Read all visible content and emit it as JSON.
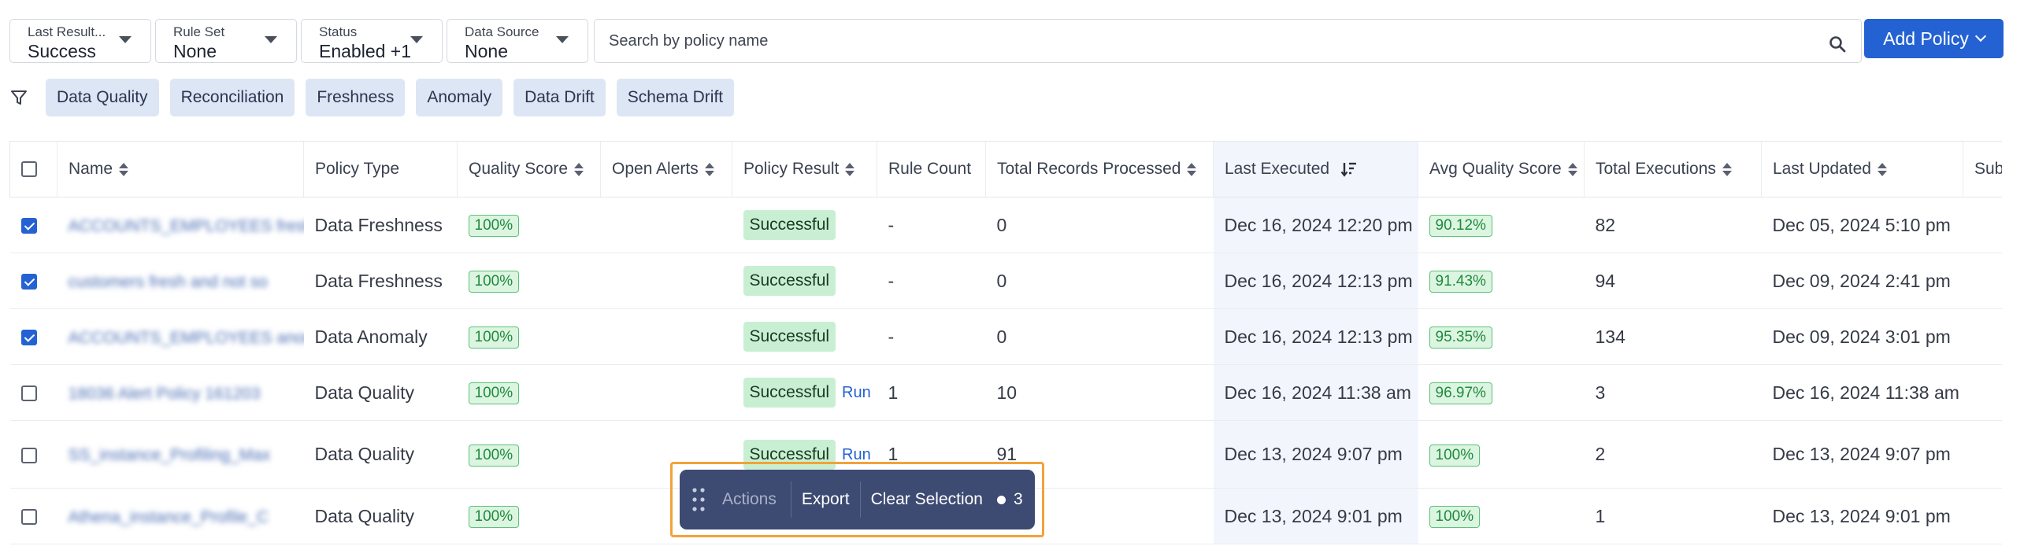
{
  "filters": [
    {
      "label": "Last Result...",
      "value": "Success"
    },
    {
      "label": "Rule Set",
      "value": "None"
    },
    {
      "label": "Status",
      "value": "Enabled +1"
    },
    {
      "label": "Data Source",
      "value": "None"
    }
  ],
  "search": {
    "placeholder": "Search by policy name",
    "value": ""
  },
  "add_policy_label": "Add Policy",
  "chips": [
    "Data Quality",
    "Reconciliation",
    "Freshness",
    "Anomaly",
    "Data Drift",
    "Schema Drift"
  ],
  "columns": [
    "Name",
    "Policy Type",
    "Quality Score",
    "Open Alerts",
    "Policy Result",
    "Rule Count",
    "Total Records Processed",
    "Last Executed",
    "Avg Quality Score",
    "Total Executions",
    "Last Updated",
    "Sub"
  ],
  "rows": [
    {
      "checked": true,
      "name": "ACCOUNTS_EMPLOYEES fresh",
      "type": "Data Freshness",
      "score": "100%",
      "alerts": "",
      "result": "Successful",
      "run": "",
      "rule_count": "-",
      "records": "0",
      "last_executed": "Dec 16, 2024 12:20 pm",
      "avg_score": "90.12%",
      "executions": "82",
      "last_updated": "Dec 05, 2024 5:10 pm"
    },
    {
      "checked": true,
      "name": "customers fresh and not so",
      "type": "Data Freshness",
      "score": "100%",
      "alerts": "",
      "result": "Successful",
      "run": "",
      "rule_count": "-",
      "records": "0",
      "last_executed": "Dec 16, 2024 12:13 pm",
      "avg_score": "91.43%",
      "executions": "94",
      "last_updated": "Dec 09, 2024 2:41 pm"
    },
    {
      "checked": true,
      "name": "ACCOUNTS_EMPLOYEES anom",
      "type": "Data Anomaly",
      "score": "100%",
      "alerts": "",
      "result": "Successful",
      "run": "",
      "rule_count": "-",
      "records": "0",
      "last_executed": "Dec 16, 2024 12:13 pm",
      "avg_score": "95.35%",
      "executions": "134",
      "last_updated": "Dec 09, 2024 3:01 pm"
    },
    {
      "checked": false,
      "name": "18036 Alert Policy 161203",
      "type": "Data Quality",
      "score": "100%",
      "alerts": "",
      "result": "Successful",
      "run": "Run",
      "rule_count": "1",
      "records": "10",
      "last_executed": "Dec 16, 2024 11:38 am",
      "avg_score": "96.97%",
      "executions": "3",
      "last_updated": "Dec 16, 2024 11:38 am"
    },
    {
      "checked": false,
      "name": "SS_instance_Profiling_Max",
      "type": "Data Quality",
      "score": "100%",
      "alerts": "",
      "result": "Successful",
      "run": "Run",
      "rule_count": "1",
      "records": "91",
      "last_executed": "Dec 13, 2024 9:07 pm",
      "avg_score": "100%",
      "executions": "2",
      "last_updated": "Dec 13, 2024 9:07 pm"
    },
    {
      "checked": false,
      "name": "Athena_instance_Profile_C",
      "type": "Data Quality",
      "score": "100%",
      "alerts": "",
      "result": "",
      "run": "",
      "rule_count": "",
      "records": "",
      "last_executed": "Dec 13, 2024 9:01 pm",
      "avg_score": "100%",
      "executions": "1",
      "last_updated": "Dec 13, 2024 9:01 pm"
    }
  ],
  "action_bar": {
    "actions_label": "Actions",
    "export_label": "Export",
    "clear_label": "Clear Selection",
    "selected_count": "3"
  },
  "colors": {
    "primary": "#2462d3",
    "chip_bg": "#dde6f5",
    "success_bg": "#c9efd3",
    "score_green": "#1f8a3d",
    "action_bar_bg": "#3d4a72",
    "highlight_border": "#f2a23a"
  },
  "icons": [
    "search-icon",
    "funnel-icon",
    "sort-icon",
    "sort-desc-icon",
    "grip-icon",
    "checkbox",
    "chevron-down-icon"
  ]
}
